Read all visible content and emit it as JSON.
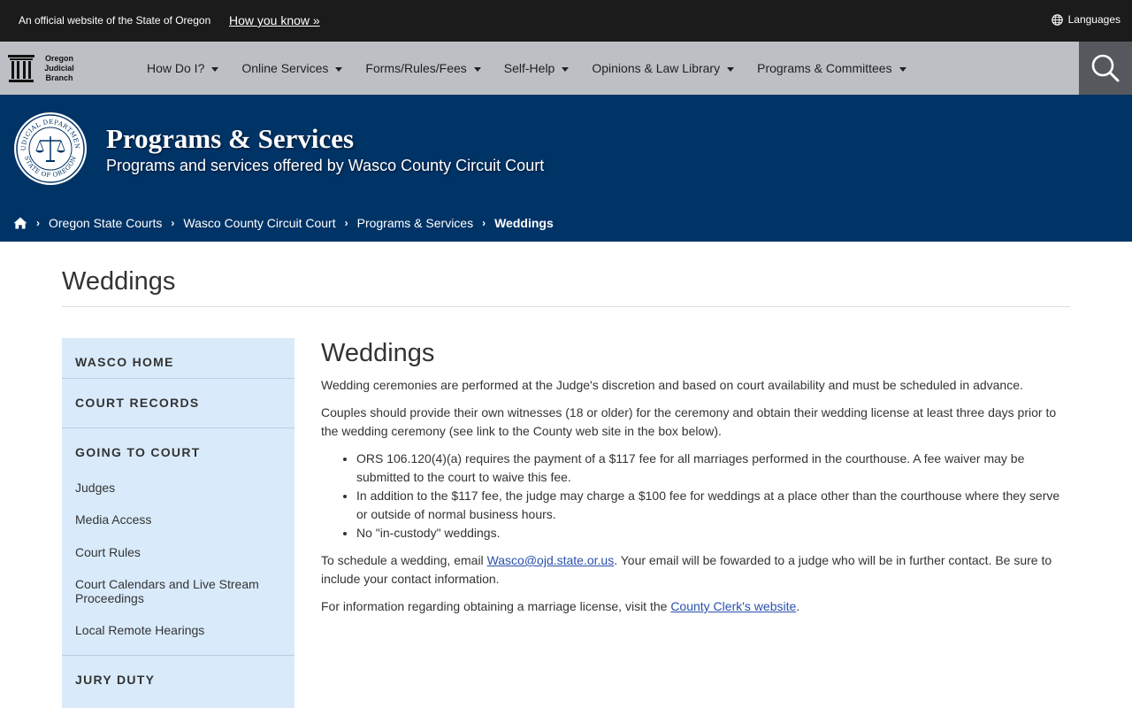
{
  "topbar": {
    "official_text": "An official website of the State of Oregon",
    "how_you_know": "How you know »",
    "languages": "Languages"
  },
  "logo": {
    "line1": "Oregon",
    "line2": "Judicial",
    "line3": "Branch"
  },
  "nav": {
    "items": [
      {
        "label": "How Do I?"
      },
      {
        "label": "Online Services"
      },
      {
        "label": "Forms/Rules/Fees"
      },
      {
        "label": "Self-Help"
      },
      {
        "label": "Opinions & Law Library"
      },
      {
        "label": "Programs & Committees"
      }
    ]
  },
  "banner": {
    "title": "Programs & Services",
    "subtitle": "Programs and services offered by Wasco County Circuit Court",
    "seal_text_top": "JUDICIAL DEPARTMENT",
    "seal_text_bottom": "STATE OF OREGON"
  },
  "breadcrumb": {
    "items": [
      "Oregon State Courts",
      "Wasco County Circuit Court",
      "Programs & Services"
    ],
    "current": "Weddings"
  },
  "page": {
    "title": "Weddings"
  },
  "sidebar": {
    "wasco_home": "WASCO HOME",
    "court_records": "COURT RECORDS",
    "going_to_court": "GOING TO COURT",
    "links": [
      "Judges",
      "Media Access",
      "Court Rules",
      "Court Calendars and Live Stream Proceedings",
      "Local Remote Hearings"
    ],
    "jury_duty": "JURY DUTY"
  },
  "content": {
    "heading": "Weddings",
    "p1": "Wedding ceremonies are performed at the Judge's discretion and based on court availability and must be scheduled in advance.",
    "p2": "Couples should provide their own witnesses (18 or older) for the ceremony and obtain their wedding license at least three days prior to the wedding ceremony (see link to the County web site in the box below).",
    "bullets": [
      "ORS 106.120(4)(a) requires the payment of a $117 fee for all marriages performed in the courthouse. A fee waiver may be submitted to the court to waive this fee.",
      "In addition to the $117 fee, the judge may charge a $100 fee for weddings at a place other than the courthouse where they serve or outside of normal business hours.",
      "No \"in-custody\" weddings."
    ],
    "p3_before": "To schedule a wedding, email ",
    "p3_link": "Wasco@ojd.state.or.us",
    "p3_after": ". Your email will be fowarded to a judge who will be in further contact. Be sure to include your contact information.",
    "p4_before": "For information regarding obtaining a marriage license, visit the ",
    "p4_link": "County Clerk's website",
    "p4_after": "."
  },
  "colors": {
    "topbar": "#1b1b1b",
    "navbar": "#bcc0c5",
    "search_button": "#55595e",
    "banner": "#003366",
    "sidebar": "#d9ebfb"
  },
  "icons": {
    "language": "globe-icon",
    "search": "search-icon",
    "home": "home-icon",
    "logo": "courthouse-pillars-icon",
    "seal": "scales-of-justice-icon"
  }
}
